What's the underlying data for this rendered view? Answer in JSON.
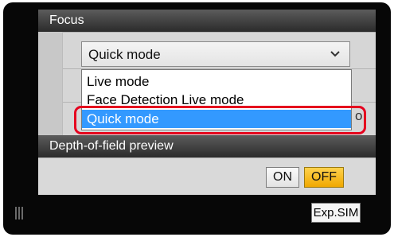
{
  "focus": {
    "title": "Focus",
    "select": {
      "value": "Quick mode"
    },
    "options": [
      {
        "label": "Live mode"
      },
      {
        "label": "Face Detection Live mode"
      },
      {
        "label": "Quick mode"
      }
    ],
    "partial_text": "o"
  },
  "dof": {
    "title": "Depth-of-field preview",
    "on_label": "ON",
    "off_label": "OFF"
  },
  "expsim": {
    "label": "Exp.SIM"
  },
  "colors": {
    "selected_option": "#3399ff",
    "highlight_border": "#e5001e",
    "off_active": "#f0a800"
  },
  "icons": {
    "dropdown": "chevron-down-icon",
    "grip": "grip-icon"
  }
}
